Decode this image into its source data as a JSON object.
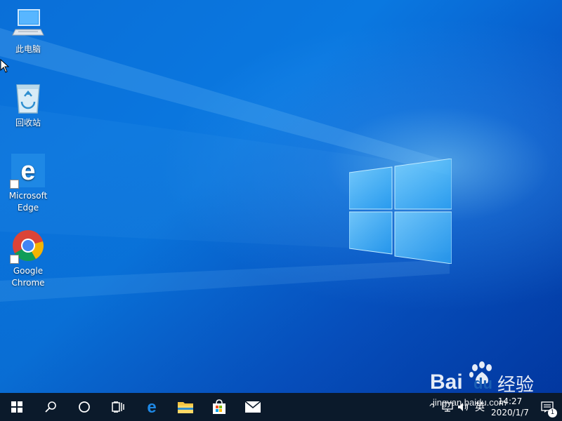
{
  "desktop": {
    "icons": [
      {
        "label": "此电脑",
        "icon": "this-pc-icon"
      },
      {
        "label": "回收站",
        "icon": "recycle-bin-icon"
      },
      {
        "label": "Microsoft Edge",
        "line1": "Microsoft",
        "line2": "Edge",
        "icon": "edge-icon"
      },
      {
        "label": "Google Chrome",
        "line1": "Google",
        "line2": "Chrome",
        "icon": "chrome-icon"
      }
    ]
  },
  "taskbar": {
    "buttons": [
      {
        "name": "start",
        "icon": "windows-start-icon"
      },
      {
        "name": "search",
        "icon": "search-icon"
      },
      {
        "name": "cortana",
        "icon": "cortana-circle-icon"
      },
      {
        "name": "task-view",
        "icon": "task-view-icon"
      },
      {
        "name": "edge",
        "icon": "edge-icon"
      },
      {
        "name": "file-explorer",
        "icon": "folder-icon"
      },
      {
        "name": "store",
        "icon": "store-bag-icon"
      },
      {
        "name": "mail",
        "icon": "mail-icon"
      }
    ],
    "tray": {
      "chevron": "^",
      "ime": "英",
      "time": "14:27",
      "date": "2020/1/7",
      "notification_count": "1"
    }
  },
  "watermark": {
    "brand": "Bai",
    "brand2": "du",
    "product": "经验",
    "url": "jingyan.baidu.com"
  },
  "colors": {
    "desktop_blue": "#0a78e0",
    "taskbar": "#0b1a2b",
    "edge_blue": "#1e88e5"
  }
}
